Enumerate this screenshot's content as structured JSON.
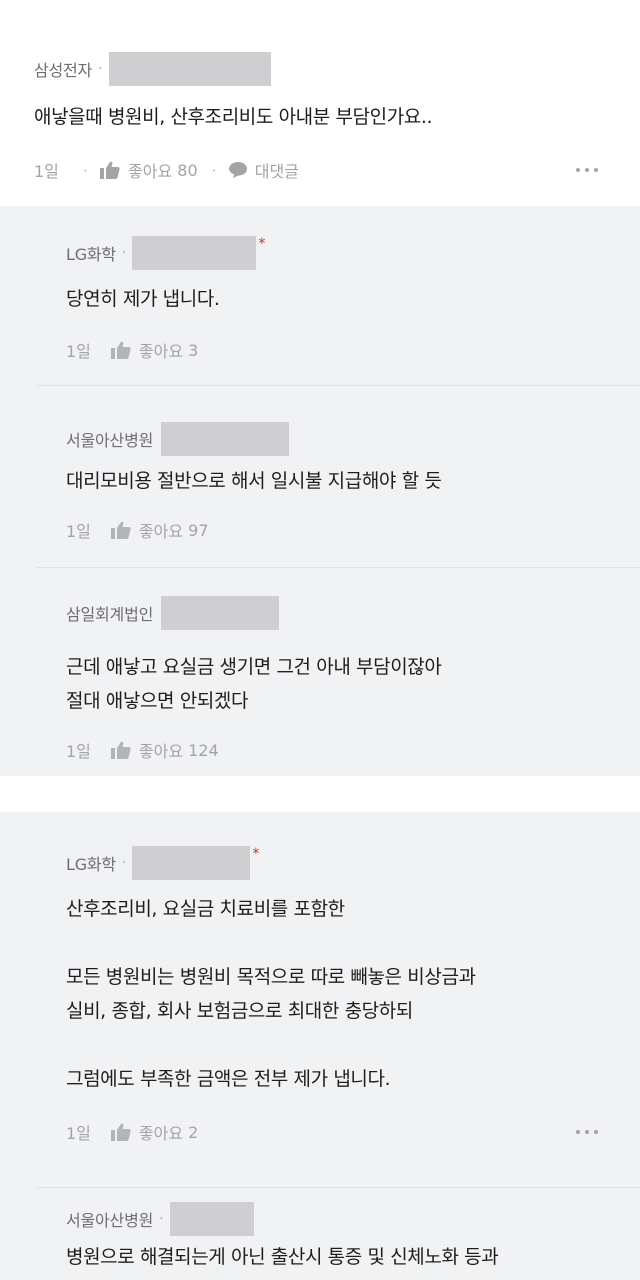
{
  "post": {
    "company": "삼성전자",
    "text": "애낳을때 병원비, 산후조리비도 아내분 부담인가요..",
    "time": "1일",
    "like_label": "좋아요",
    "likes": "80",
    "reply_label": "대댓글",
    "more_icon": "more-dots-icon"
  },
  "replies": [
    {
      "company": "LG화학",
      "lines": [
        "당연히 제가 냅니다."
      ],
      "time": "1일",
      "like_label": "좋아요",
      "likes": "3",
      "author_mark": "*"
    },
    {
      "company": "서울아산병원",
      "lines": [
        "대리모비용 절반으로 해서 일시불 지급해야 할 듯"
      ],
      "time": "1일",
      "like_label": "좋아요",
      "likes": "97"
    },
    {
      "company": "삼일회계법인",
      "lines": [
        "근데 애낳고 요실금 생기면 그건 아내 부담이잖아",
        "절대 애낳으면 안되겠다"
      ],
      "time": "1일",
      "like_label": "좋아요",
      "likes": "124"
    },
    {
      "company": "LG화학",
      "lines": [
        "산후조리비, 요실금 치료비를 포함한",
        "모든 병원비는 병원비 목적으로 따로 빼놓은 비상금과",
        "실비, 종합, 회사 보험금으로 최대한 충당하되",
        "그럼에도 부족한 금액은 전부 제가 냅니다."
      ],
      "time": "1일",
      "like_label": "좋아요",
      "likes": "2",
      "author_mark": "*"
    },
    {
      "company": "서울아산병원",
      "lines": [
        "병원으로 해결되는게 아닌 출산시 통증 및 신체노화 등과"
      ]
    }
  ]
}
